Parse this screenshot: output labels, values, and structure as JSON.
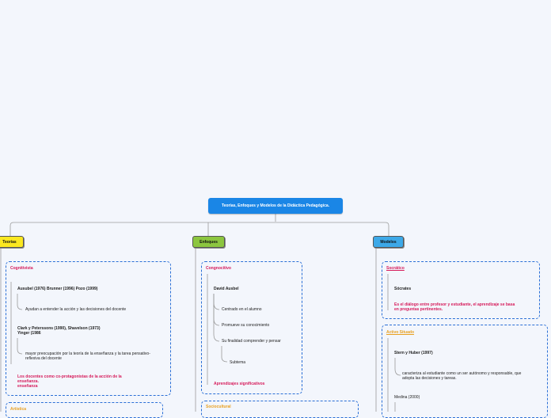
{
  "root": {
    "title": "Teorías, Enfoques  y Modelos de la Didáctica Pedagógica."
  },
  "branches": {
    "teorias": "Teorías",
    "enfoques": "Enfoques",
    "modelos": "Modelos"
  },
  "teorias": {
    "cognitivista": {
      "title": "Cognitivista",
      "ausubel": "Ausubel (1976) Brunner (1996) Pozo (1999)",
      "ausubel_note": "Ayudan a entender la acción y las decisiones del docente",
      "clark_line1": "Clark y Peterssons (1990), Shavelson (1973)",
      "clark_line2": "Yinger (1986",
      "clark_note_line1": "mayor preocupación por la teoría de la enseñanza y la tarea pensativo-",
      "clark_note_line2": "reflexiva del docente",
      "docentes_line1": "Los docentes como co-protagonistas de la acción de la",
      "docentes_line2": "enseñanza.",
      "docentes_line3": "enseñanza"
    },
    "artistica": {
      "title": "Artística"
    }
  },
  "enfoques": {
    "cognoscitivo": {
      "title": "Congnocitivo",
      "ausbel": "David Ausbel",
      "items": [
        "Centrado en el alumno",
        "Promueve su conocimiento",
        "Su finalidad comprender y pensar"
      ],
      "subtema": "Subtema",
      "aprendizajes": "Aprendizajes significativos"
    },
    "sociocultural": {
      "title": "Sociocultural"
    }
  },
  "modelos": {
    "socratico": {
      "title": "Socrático",
      "socrates": "Sócrates",
      "note_line1": "Es el diálogo entre profesor y estudiante, el aprendizaje se basa",
      "note_line2": "en preguntas pertinentes."
    },
    "activo": {
      "title": "Activo Situado",
      "stern": "Stern y Huber (1997)",
      "stern_note_line1": "caracteriza al estudiante como un ser autónomo y responsable, que",
      "stern_note_line2": "adopta las decisiones y tareas.",
      "medina": "Medina (2000)"
    }
  },
  "colors": {
    "root": "#1a86e6",
    "teorias": "#fbe821",
    "enfoques": "#8cc63f",
    "modelos": "#3da9e8",
    "dashed": "#2a6fd6",
    "accent_text": "#d61a5a",
    "orange_text": "#e8a020"
  }
}
